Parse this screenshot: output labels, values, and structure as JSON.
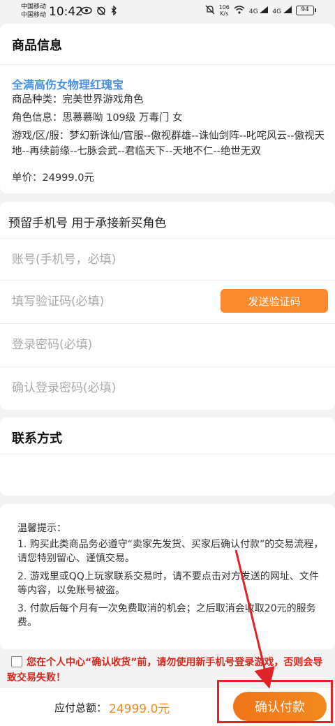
{
  "status_bar": {
    "carrier1": "中国移动",
    "carrier2": "中国移动",
    "time": "10:42",
    "net_speed_value": "106",
    "net_speed_unit": "K/s",
    "signal1": "4G",
    "signal2": "4G",
    "battery": "94"
  },
  "product": {
    "section_title": "商品信息",
    "name": "全满高伤女物理红瑰宝",
    "type_line": "商品种类：完美世界游戏角色",
    "role_line": "角色信息：思慕慕呦 109级 万毒门 女",
    "server_line": "游戏/区/服：梦幻新诛仙/官服--傲视群雄--诛仙剑阵--叱咤风云--傲视天地--再续前缘--七脉会武--君临天下--天地不仁--绝世无双",
    "price_line": "单价：24999.0元"
  },
  "phone_section": {
    "title": "预留手机号 用于承接新买角色",
    "account_placeholder": "账号(手机号，必填)",
    "code_placeholder": "填写验证码(必填)",
    "send_code_label": "发送验证码",
    "password_placeholder": "登录密码(必填)",
    "confirm_password_placeholder": "确认登录密码(必填)"
  },
  "contact": {
    "section_title": "联系方式"
  },
  "tips": {
    "title": "温馨提示：",
    "items": [
      "1. 购买此类商品务必遵守“卖家先发货、买家后确认付款”的交易流程，请您特别留心、谨慎交易。",
      "2. 游戏里或QQ上玩家联系交易时，请不要点击对方发送的网址、文件等内容，以免账号被盗。",
      "3. 付款后每个月有一次免费取消的机会；之后取消会收取20元的服务费。"
    ]
  },
  "agreement": {
    "text": "您在个人中心“确认收货”前，请勿使用新手机号登录游戏，否则会导致交易失败！",
    "checked": false
  },
  "bottom_bar": {
    "total_label": "应付总额：",
    "total_value": "24999.0元",
    "pay_button": "确认付款"
  },
  "colors": {
    "accent_orange": "#fa8a2c",
    "price_orange": "#f08a1c",
    "link_blue": "#4a90e2",
    "warning_red": "#d9261c",
    "annotation_red": "#e0242a"
  }
}
